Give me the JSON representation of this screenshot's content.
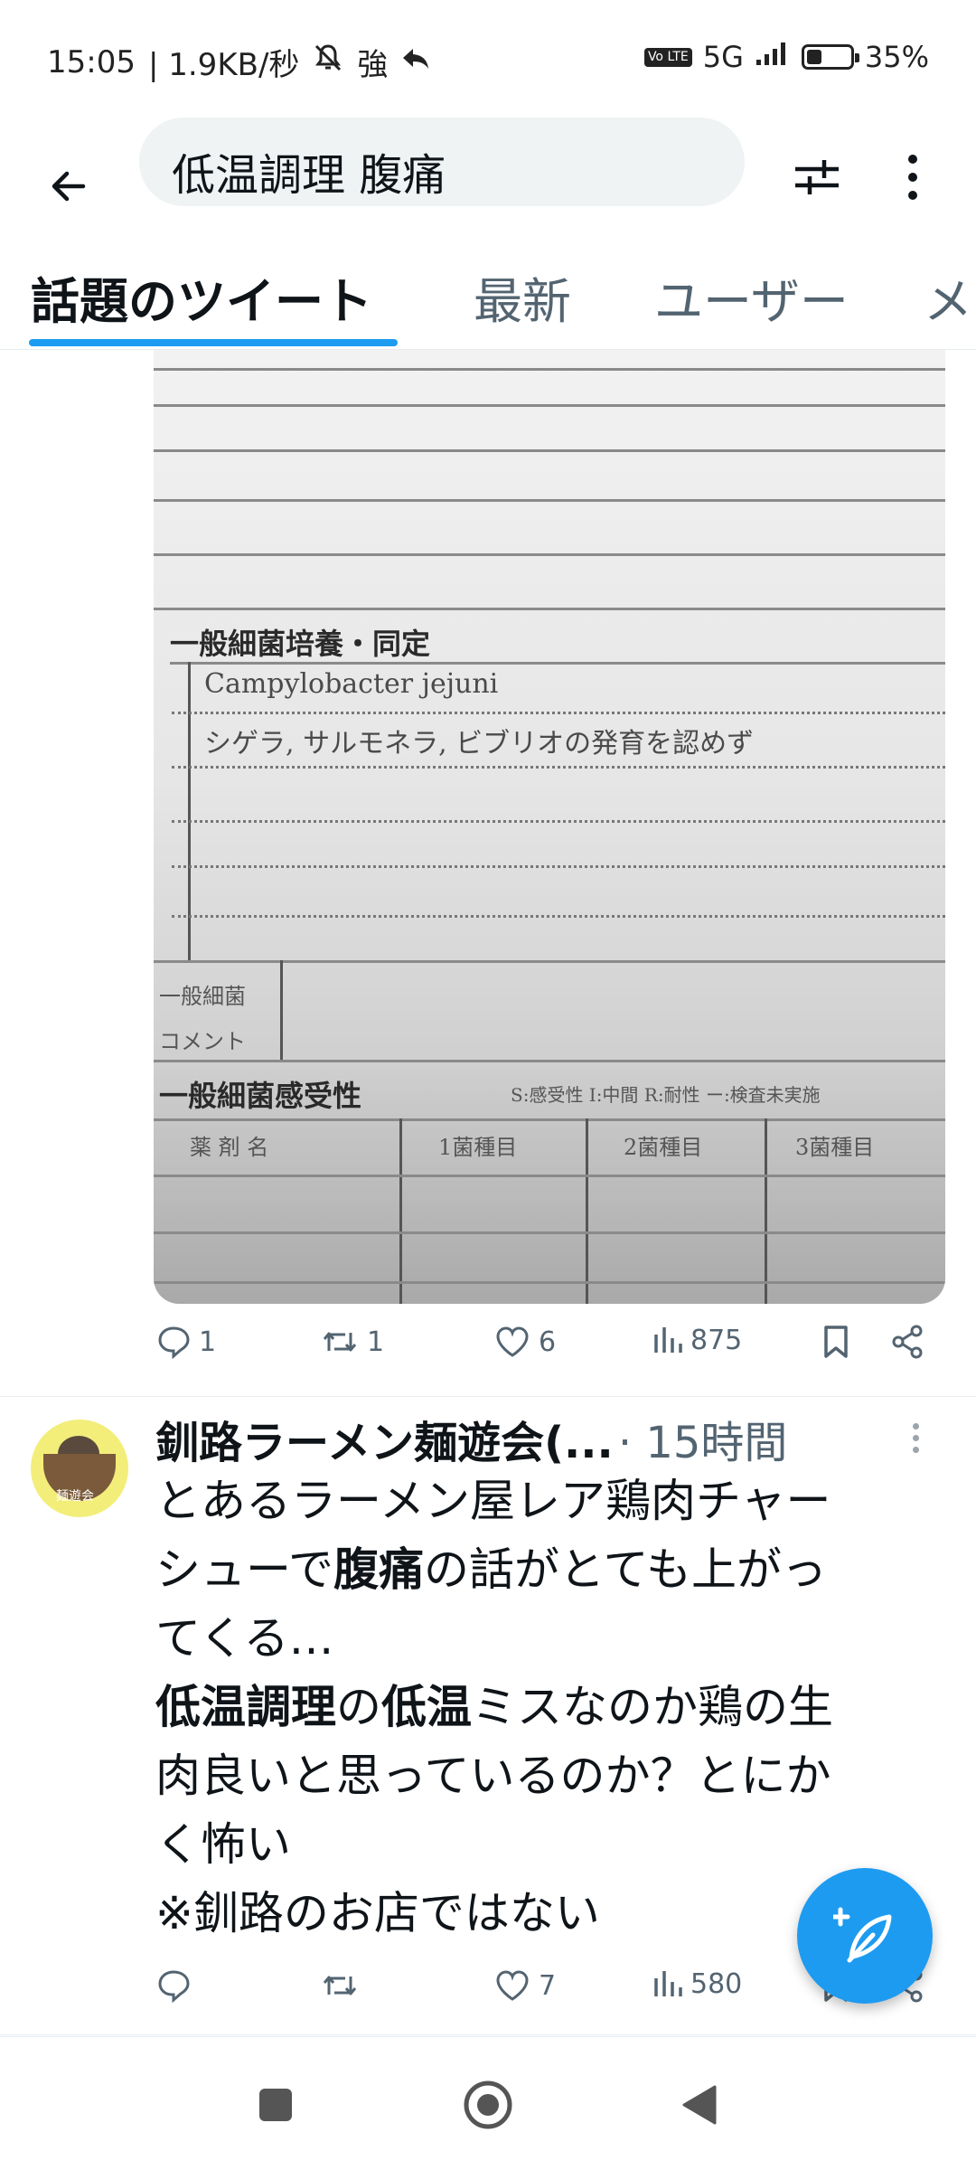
{
  "status_bar": {
    "time": "15:05",
    "speed": "| 1.9KB/秒",
    "signal_text": "強",
    "network": "5G",
    "volte_label": "Vo LTE",
    "battery_text": "35%",
    "battery_level": 0.35
  },
  "search": {
    "query": "低温調理 腹痛"
  },
  "tabs": [
    {
      "label": "話題のツイート",
      "active": true
    },
    {
      "label": "最新",
      "active": false
    },
    {
      "label": "ユーザー",
      "active": false
    },
    {
      "label": "メ",
      "active": false
    }
  ],
  "image_doc": {
    "heading1": "一般細菌培養・同定",
    "organism": "Campylobacter jejuni",
    "note": "シゲラ, サルモネラ, ビブリオの発育を認めず",
    "row_label_1": "一般細菌",
    "row_label_2": "コメント",
    "heading2": "一般細菌感受性",
    "heading2_small": "S:感受性 I:中間 R:耐性 ー:検査未実施",
    "col1": "薬 剤 名",
    "col2": "1菌種目",
    "col3": "2菌種目",
    "col4": "3菌種目"
  },
  "tweet1": {
    "replies": "1",
    "retweets": "1",
    "likes": "6",
    "views": "875"
  },
  "tweet2": {
    "author": "釧路ラーメン麺遊会(...",
    "time": "· 15時間",
    "avatar_text": "麺遊会",
    "body_lines": [
      [
        {
          "t": "とあるラーメン屋レア鶏肉チャー",
          "b": false
        }
      ],
      [
        {
          "t": "シューで",
          "b": false
        },
        {
          "t": "腹痛",
          "b": true
        },
        {
          "t": "の話がとても上がっ",
          "b": false
        }
      ],
      [
        {
          "t": "てくる…",
          "b": false
        }
      ],
      [
        {
          "t": "低温調理",
          "b": true
        },
        {
          "t": "の",
          "b": false
        },
        {
          "t": "低温",
          "b": true
        },
        {
          "t": "ミスなのか鶏の生",
          "b": false
        }
      ],
      [
        {
          "t": "肉良いと思っているのか？とにか",
          "b": false
        }
      ],
      [
        {
          "t": "く怖い",
          "b": false
        }
      ],
      [
        {
          "t": "※釧路のお店ではない",
          "b": false
        }
      ]
    ],
    "replies": "",
    "retweets": "",
    "likes": "7",
    "views": "580"
  },
  "colors": {
    "accent": "#1d9bf0",
    "text_primary": "#0f1419",
    "text_secondary": "#536471"
  }
}
